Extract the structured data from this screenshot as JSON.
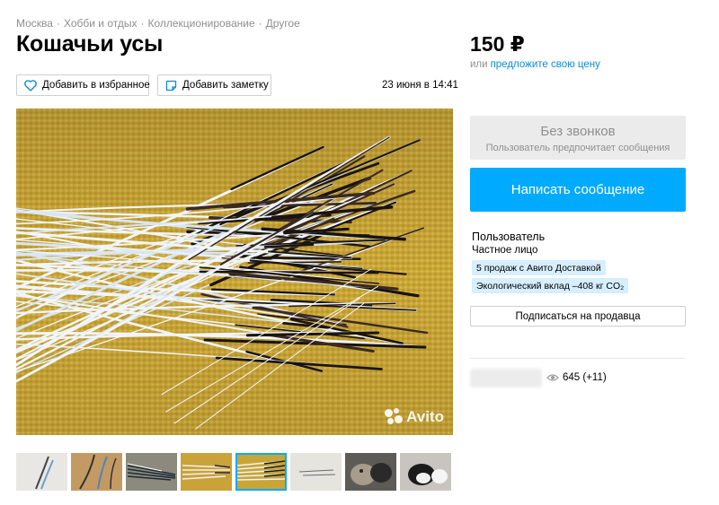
{
  "breadcrumb": [
    "Москва",
    "Хобби и отдых",
    "Коллекционирование",
    "Другое"
  ],
  "title": "Кошачьи усы",
  "price": {
    "value": "150 ₽",
    "offer_prefix": "или",
    "offer_link": "предложите свою цену"
  },
  "actions": {
    "favorite_label": "Добавить в избранное",
    "note_label": "Добавить заметку"
  },
  "date": "23 июня в 14:41",
  "photo": {
    "watermark": "Avito",
    "thumbnail_count": 8,
    "active_thumbnail": 5
  },
  "contact": {
    "no_calls_title": "Без звонков",
    "no_calls_subtitle": "Пользователь предпочитает сообщения",
    "message_button": "Написать сообщение"
  },
  "seller": {
    "name": "Пользователь",
    "type": "Частное лицо",
    "badges": [
      "5 продаж с Авито Доставкой",
      "Экологический вклад –408 кг CO₂"
    ],
    "subscribe_label": "Подписаться на продавца"
  },
  "stats": {
    "views": "645 (+11)"
  },
  "colors": {
    "accent": "#00aaff",
    "link": "#0a8cd3",
    "badge_bg": "#d6eefd"
  }
}
